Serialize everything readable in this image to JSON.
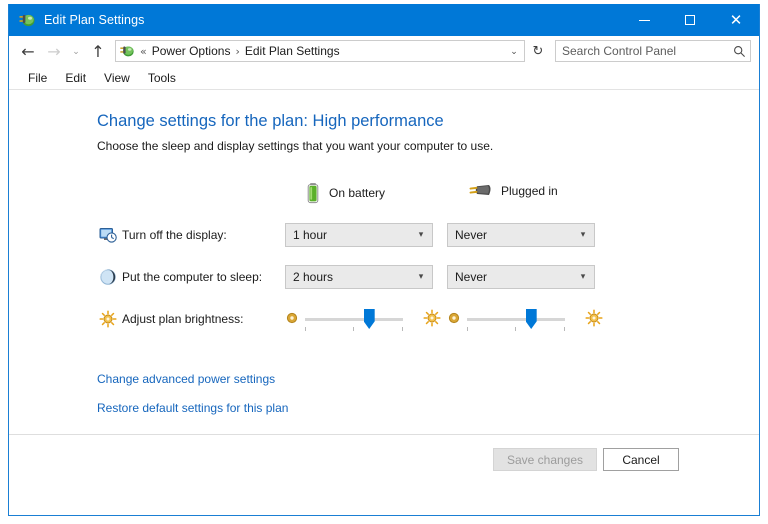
{
  "window": {
    "title": "Edit Plan Settings",
    "icon": "power-plug-icon",
    "caption": {
      "minimize": "minimize-icon",
      "maximize": "maximize-icon",
      "close": "close-icon"
    }
  },
  "navbar": {
    "back": "←",
    "forward": "→",
    "recent": "⌄",
    "up": "↑",
    "refresh": "↻",
    "address_icon": "power-plug-icon",
    "breadcrumbs": [
      {
        "label": "«",
        "type": "overflow"
      },
      {
        "label": "Power Options",
        "type": "crumb"
      },
      {
        "label": "Edit Plan Settings",
        "type": "crumb"
      }
    ],
    "dropdown": "⌄"
  },
  "search": {
    "placeholder": "Search Control Panel",
    "value": "",
    "icon": "search-icon"
  },
  "menubar": {
    "items": [
      {
        "label": "File"
      },
      {
        "label": "Edit"
      },
      {
        "label": "View"
      },
      {
        "label": "Tools"
      }
    ]
  },
  "main": {
    "heading": "Change settings for the plan: High performance",
    "subheading": "Choose the sleep and display settings that you want your computer to use.",
    "columns": [
      {
        "label": "On battery",
        "icon": "battery-icon"
      },
      {
        "label": "Plugged in",
        "icon": "power-plug-icon"
      }
    ],
    "rows": [
      {
        "id": "turn-off-display",
        "label": "Turn off the display:",
        "icon": "monitor-clock-icon",
        "type": "dropdown",
        "on_battery": "1 hour",
        "plugged_in": "Never"
      },
      {
        "id": "put-computer-to-sleep",
        "label": "Put the computer to sleep:",
        "icon": "moon-icon",
        "type": "dropdown",
        "on_battery": "2 hours",
        "plugged_in": "Never"
      },
      {
        "id": "adjust-plan-brightness",
        "label": "Adjust plan brightness:",
        "icon": "sun-icon",
        "type": "slider",
        "on_battery_percent": 65,
        "plugged_in_percent": 65,
        "min_icon": "sun-dim-icon",
        "max_icon": "sun-bright-icon"
      }
    ],
    "links": [
      {
        "id": "change-advanced-power-settings",
        "label": "Change advanced power settings"
      },
      {
        "id": "restore-default-settings",
        "label": "Restore default settings for this plan"
      }
    ]
  },
  "footer": {
    "save": {
      "label": "Save changes",
      "enabled": false
    },
    "cancel": {
      "label": "Cancel",
      "enabled": true
    }
  },
  "colors": {
    "titlebar": "#0078d7",
    "accent": "#0078d7",
    "link": "#1666bd",
    "heading": "#1666bd",
    "battery_green": "#5bb02a",
    "sun_gold": "#e8a317"
  }
}
